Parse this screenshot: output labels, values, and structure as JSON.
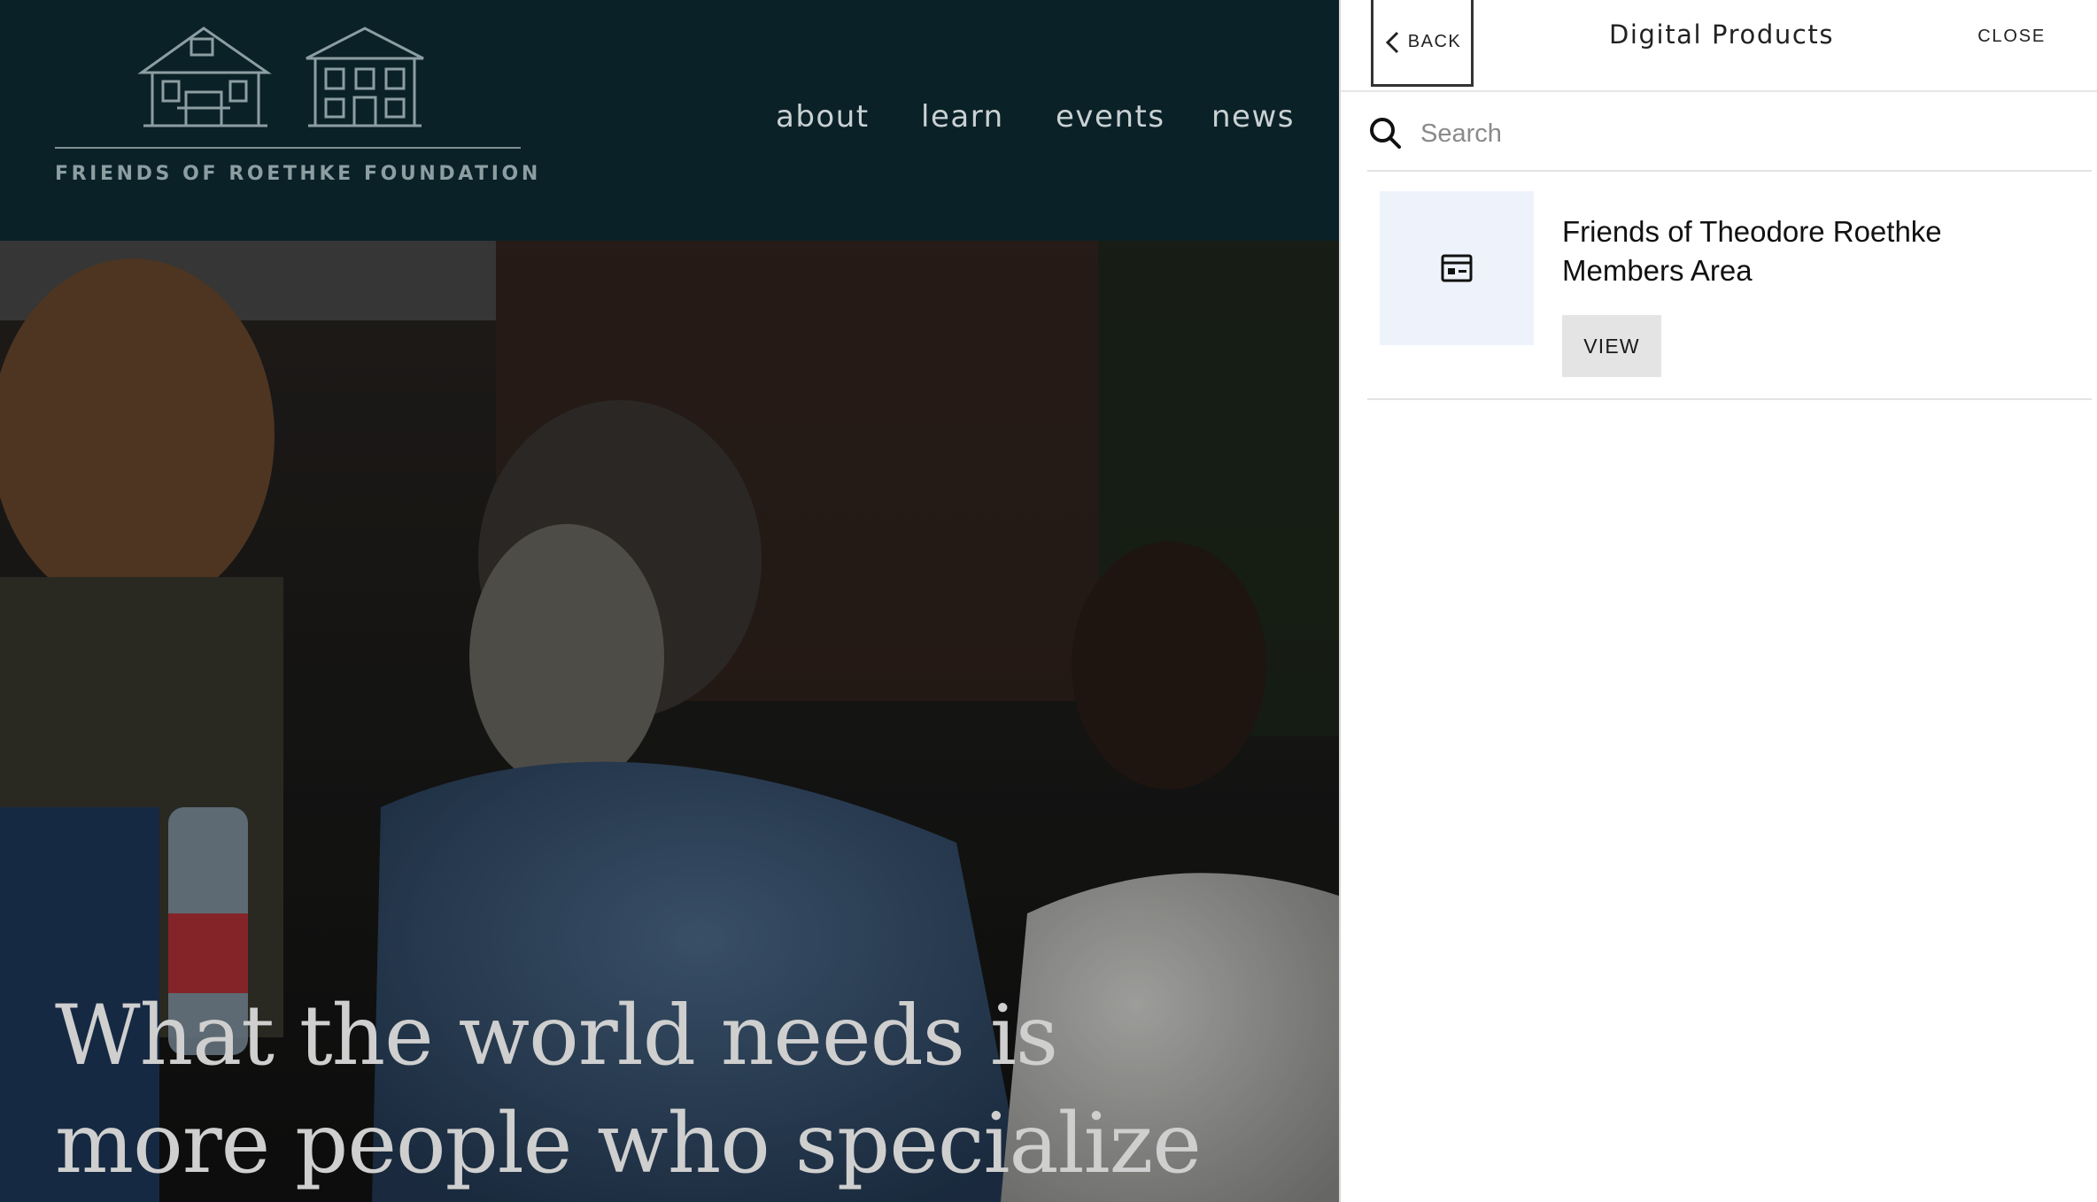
{
  "site": {
    "logo_text": "FRIENDS OF ROETHKE FOUNDATION",
    "nav": [
      {
        "label": "about"
      },
      {
        "label": "learn"
      },
      {
        "label": "events"
      },
      {
        "label": "news"
      }
    ],
    "hero_quote": {
      "line1": "What the world needs is",
      "line2": "more people who specialize"
    }
  },
  "panel": {
    "back_label": "BACK",
    "title": "Digital Products",
    "close_label": "CLOSE",
    "search": {
      "placeholder": "Search",
      "value": ""
    },
    "products": [
      {
        "name": "Friends of Theodore Roethke Members Area",
        "action_label": "VIEW",
        "icon": "membership-card-icon"
      }
    ]
  },
  "colors": {
    "header_bg": "#0b2128",
    "logo": "#8c9ea2",
    "thumb_bg": "#eef3fb",
    "button_bg": "#e4e4e4"
  }
}
